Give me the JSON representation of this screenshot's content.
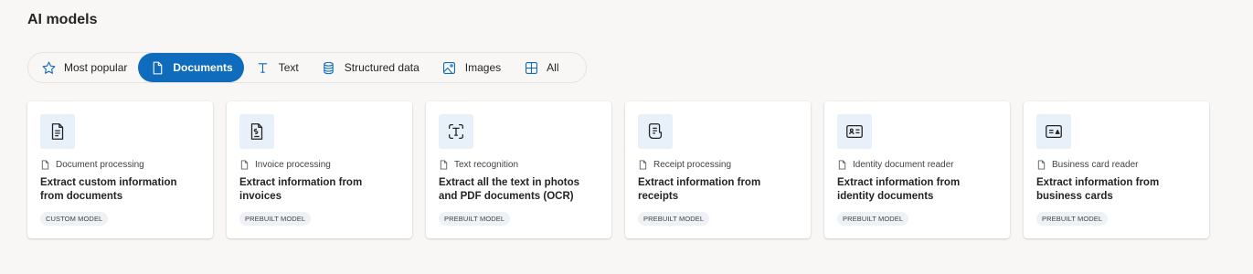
{
  "page": {
    "title": "AI models"
  },
  "tabs": [
    {
      "label": "Most popular",
      "icon": "star-icon",
      "active": false
    },
    {
      "label": "Documents",
      "icon": "document-icon",
      "active": true
    },
    {
      "label": "Text",
      "icon": "text-icon",
      "active": false
    },
    {
      "label": "Structured data",
      "icon": "database-icon",
      "active": false
    },
    {
      "label": "Images",
      "icon": "image-icon",
      "active": false
    },
    {
      "label": "All",
      "icon": "grid-icon",
      "active": false
    }
  ],
  "cards": [
    {
      "category": "Document processing",
      "title": "Extract custom information from documents",
      "badge": "CUSTOM MODEL",
      "icon": "document-text-icon"
    },
    {
      "category": "Invoice processing",
      "title": "Extract information from invoices",
      "badge": "PREBUILT MODEL",
      "icon": "invoice-icon"
    },
    {
      "category": "Text recognition",
      "title": "Extract all the text in photos and PDF documents (OCR)",
      "badge": "PREBUILT MODEL",
      "icon": "text-scan-icon"
    },
    {
      "category": "Receipt processing",
      "title": "Extract information from receipts",
      "badge": "PREBUILT MODEL",
      "icon": "receipt-icon"
    },
    {
      "category": "Identity document reader",
      "title": "Extract information from identity documents",
      "badge": "PREBUILT MODEL",
      "icon": "id-card-icon"
    },
    {
      "category": "Business card reader",
      "title": "Extract information from business cards",
      "badge": "PREBUILT MODEL",
      "icon": "business-card-icon"
    }
  ],
  "colors": {
    "accent": "#0f6cbd",
    "icon_bg": "#e8f0fa",
    "background": "#f8f7f6"
  }
}
